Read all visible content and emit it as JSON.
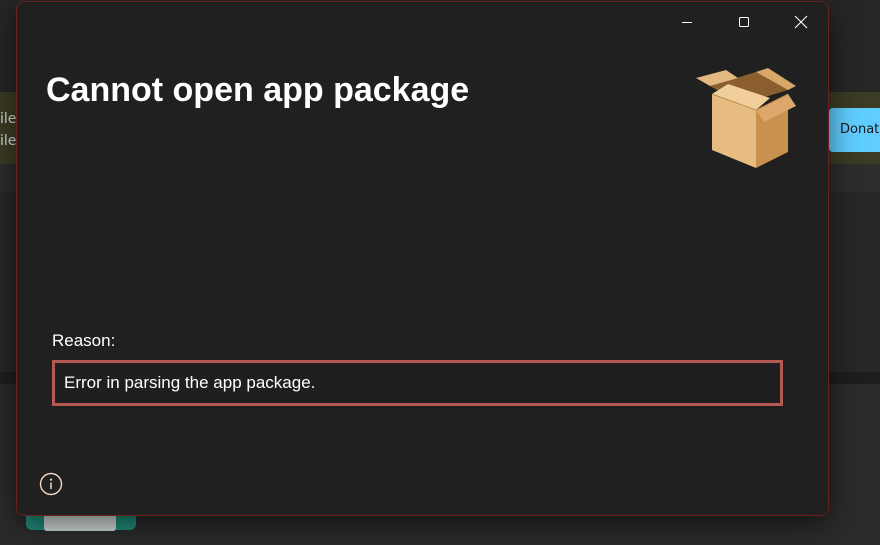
{
  "background": {
    "notice_text": "ile ile",
    "donate_label": "Donate"
  },
  "dialog": {
    "title": "Cannot open app package",
    "reason_label": "Reason:",
    "reason_text": "Error in parsing the app package.",
    "icons": {
      "minimize": "minimize-icon",
      "maximize": "maximize-icon",
      "close": "close-icon",
      "package": "package-box-icon",
      "info": "info-icon"
    },
    "colors": {
      "reason_border": "#b45a52",
      "dialog_border": "#6b1f1f"
    }
  }
}
